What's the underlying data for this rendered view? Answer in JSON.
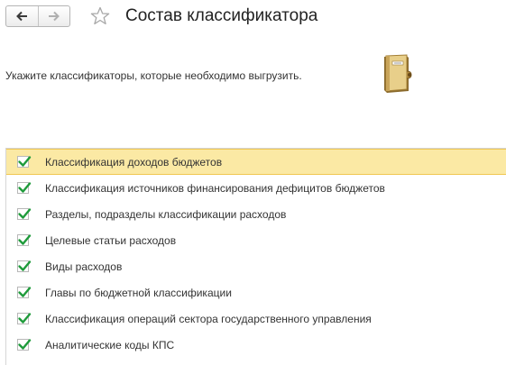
{
  "header": {
    "back_icon": "arrow-left-icon",
    "forward_icon": "arrow-right-icon",
    "favorite_icon": "star-icon",
    "title": "Состав классификатора"
  },
  "instruction": "Укажите классификаторы, которые необходимо выгрузить.",
  "book_icon": "classifier-book-icon",
  "colors": {
    "selected_row": "#fbe9a4",
    "selected_border": "#f0c751",
    "checkmark": "#1f9b3b"
  },
  "items": [
    {
      "label": "Классификация доходов бюджетов",
      "checked": true,
      "selected": true
    },
    {
      "label": "Классификация источников финансирования дефицитов бюджетов",
      "checked": true,
      "selected": false
    },
    {
      "label": "Разделы, подразделы классификации расходов",
      "checked": true,
      "selected": false
    },
    {
      "label": "Целевые статьи расходов",
      "checked": true,
      "selected": false
    },
    {
      "label": "Виды расходов",
      "checked": true,
      "selected": false
    },
    {
      "label": "Главы по бюджетной классификации",
      "checked": true,
      "selected": false
    },
    {
      "label": "Классификация операций сектора государственного управления",
      "checked": true,
      "selected": false
    },
    {
      "label": "Аналитические коды КПС",
      "checked": true,
      "selected": false
    }
  ]
}
